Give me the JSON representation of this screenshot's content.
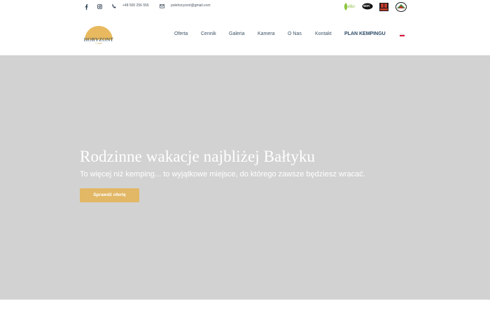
{
  "topbar": {
    "phone": "+48 500 256 556",
    "email": "polehoryzont@gmail.com",
    "badge_eko": "eko",
    "badge_wifi": "WiFi"
  },
  "logo": {
    "name": "HORYZONT",
    "subtitle": "CAMP"
  },
  "nav": {
    "items": [
      "Oferta",
      "Cennik",
      "Galeria",
      "Kamera",
      "O Nas",
      "Kontakt"
    ],
    "plan": "PLAN KEMPINGU",
    "language": "PL"
  },
  "hero": {
    "title": "Rodzinne wakacje najbliżej Bałtyku",
    "subtitle": "To więcej niż kemping... to wyjątkowe miejsce, do którego zawsze będziesz wracać.",
    "cta": "Sprawdź ofertę"
  },
  "colors": {
    "accent": "#e2b765",
    "hero_bg": "#d2d2d2",
    "nav_text": "#3d5366"
  }
}
